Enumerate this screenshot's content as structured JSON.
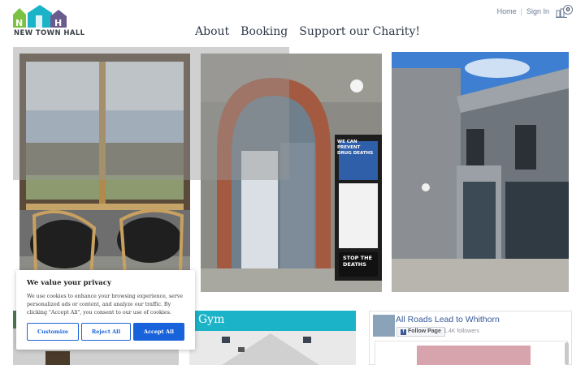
{
  "brand": {
    "name": "NEW TOWN HALL",
    "logo_letters": "NTH"
  },
  "toplinks": {
    "home": "Home",
    "signin": "Sign In",
    "cart_count": "0"
  },
  "nav": {
    "about": "About",
    "booking": "Booking",
    "support": "Support our Charity!"
  },
  "tiles": {
    "gym_title": "Gym"
  },
  "facebook": {
    "page_name": "All Roads Lead to Whithorn",
    "follow_label": "Follow Page",
    "followers": "1.4K followers"
  },
  "cookie": {
    "title": "We value your privacy",
    "text": "We use cookies to enhance your browsing experience, serve personalized ads or content, and analyze our traffic. By clicking \"Accept All\", you consent to our use of cookies.",
    "customize": "Customize",
    "reject": "Reject All",
    "accept": "Accept All"
  },
  "photo_poster": {
    "line1": "WE CAN",
    "line2": "PREVENT",
    "line3": "DRUG DEATHS",
    "footer1": "STOP THE",
    "footer2": "DEATHS"
  },
  "colors": {
    "accent_blue": "#1863dc",
    "gym_teal": "#1bb3c8",
    "logo_green": "#7bc142",
    "logo_teal": "#1bb3c8",
    "logo_purple": "#6a5c8e"
  }
}
